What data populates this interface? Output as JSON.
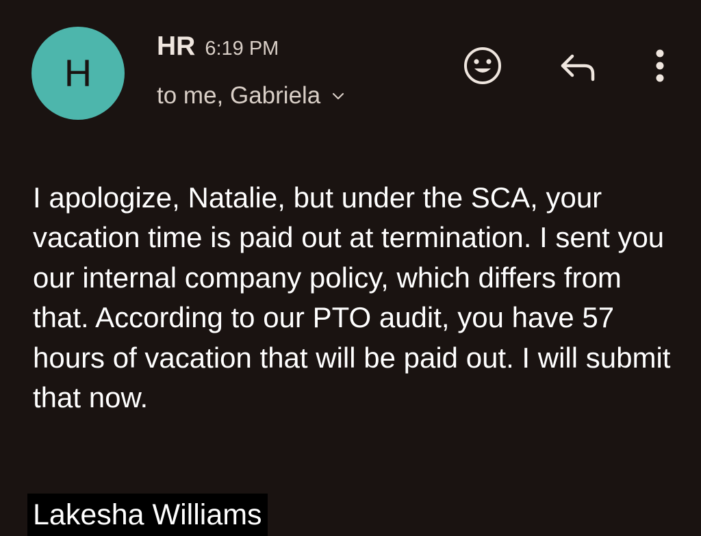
{
  "header": {
    "avatar_letter": "H",
    "avatar_color": "#4db6ac",
    "sender": "HR",
    "time": "6:19 PM",
    "recipients": "to me, Gabriela",
    "recipients_icon": "chevron-down-icon",
    "actions": [
      {
        "name": "emoji-reaction",
        "icon": "smiley-icon"
      },
      {
        "name": "reply",
        "icon": "reply-icon"
      },
      {
        "name": "more-options",
        "icon": "more-vert-icon"
      }
    ]
  },
  "body": {
    "text": "I apologize, Natalie, but under the SCA, your vacation time is paid out at termination. I sent you our internal company policy, which differs from that. According to our PTO audit, you have 57 hours of vacation that will be paid out. I will submit that now.",
    "signature": "Lakesha Williams"
  },
  "colors": {
    "background": "#1a1311",
    "text": "#ffffff",
    "secondary_text": "#d9cfc7",
    "icon": "#efe6df"
  }
}
